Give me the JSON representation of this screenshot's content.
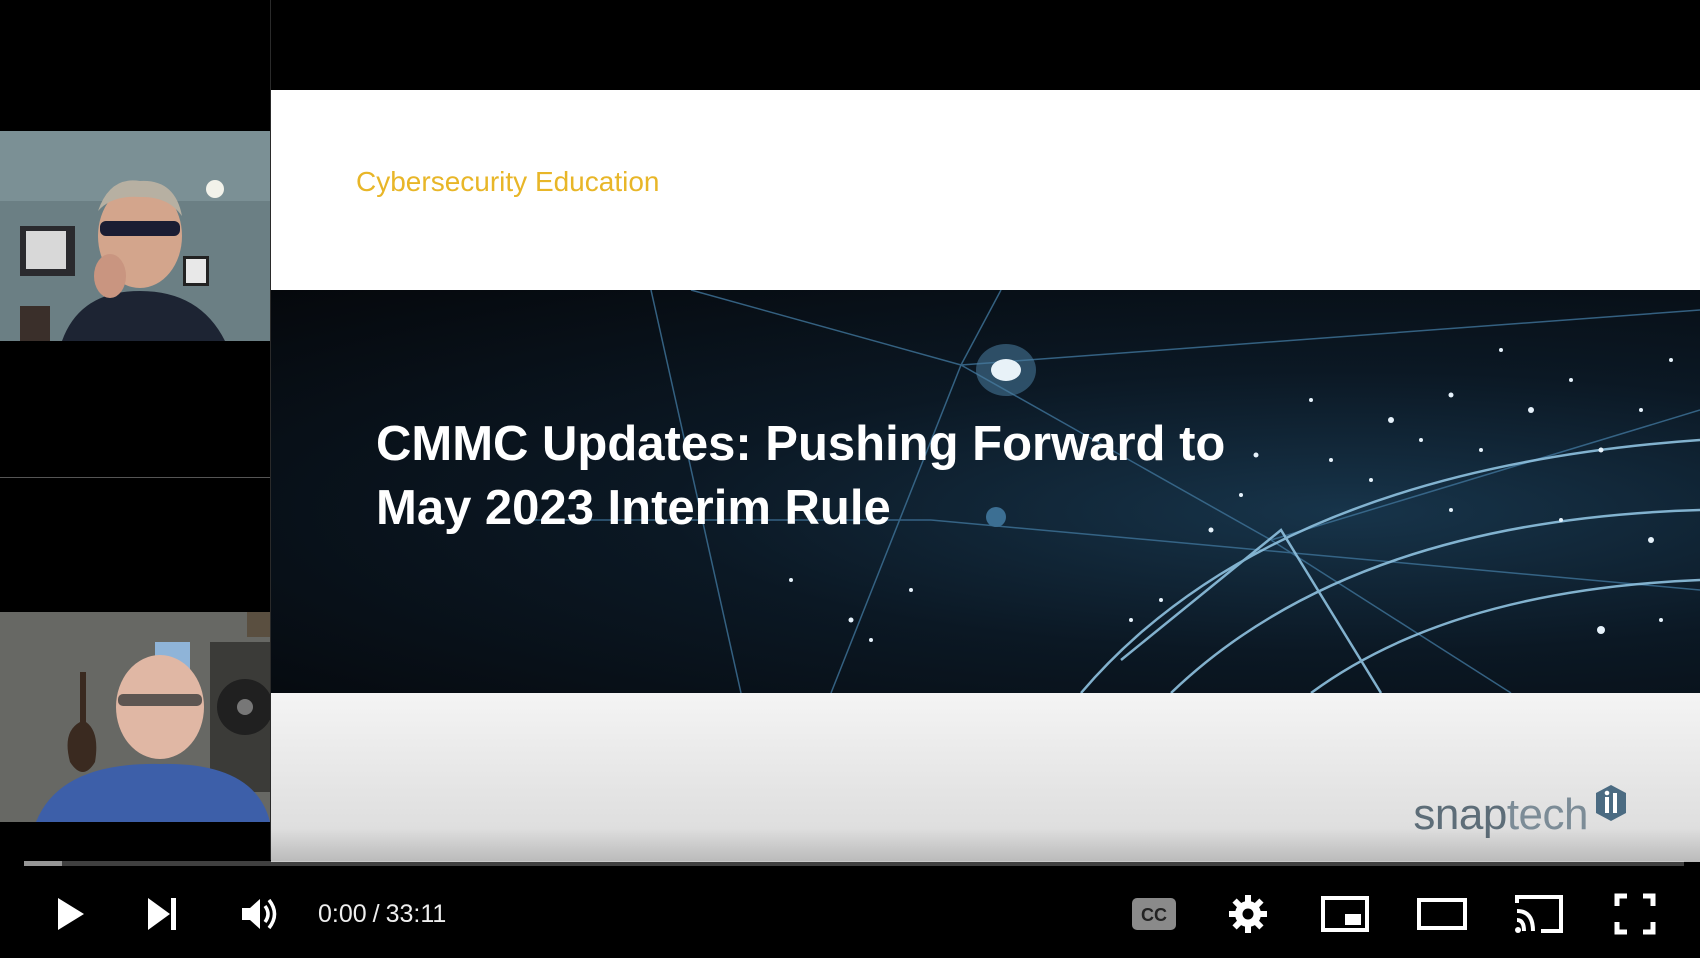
{
  "slide": {
    "kicker": "Cybersecurity Education",
    "title_line1": "CMMC Updates: Pushing Forward to",
    "title_line2": "May 2023 Interim Rule",
    "brand_name_dark": "snap",
    "brand_name_light": "tech"
  },
  "player": {
    "current_time": "0:00",
    "separator": "/",
    "duration": "33:11",
    "progress_fraction": 0.0,
    "buffered_fraction": 0.023
  },
  "controls": {
    "play_icon": "play-icon",
    "next_icon": "next-icon",
    "volume_icon": "volume-icon",
    "captions_icon": "captions-icon",
    "settings_icon": "gear-icon",
    "miniplayer_icon": "miniplayer-icon",
    "theater_icon": "theater-mode-icon",
    "cast_icon": "cast-icon",
    "fullscreen_icon": "fullscreen-icon"
  },
  "colors": {
    "kicker": "#e8b628",
    "progress_played": "#ff0000",
    "brand": "#5d6d78"
  }
}
